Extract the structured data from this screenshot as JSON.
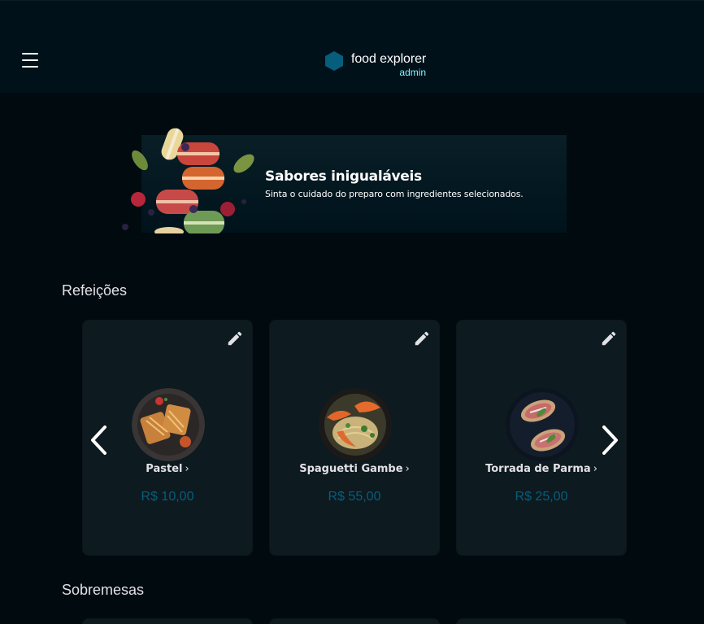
{
  "header": {
    "brand_name": "food explorer",
    "brand_role": "admin",
    "menu_icon": "hamburger-menu-icon",
    "logo_icon": "hexagon-logo-icon",
    "accent_color": "#82f3ff",
    "logo_color": "#065e7c"
  },
  "banner": {
    "title": "Sabores inigualáveis",
    "subtitle": "Sinta o cuidado do preparo com ingredientes selecionados."
  },
  "sections": [
    {
      "title": "Refeições",
      "cards": [
        {
          "name": "Pastel",
          "chevron": "›",
          "price": "R$ 10,00",
          "icon": "pencil-edit-icon"
        },
        {
          "name": "Spaguetti Gambe",
          "chevron": "›",
          "price": "R$ 55,00",
          "icon": "pencil-edit-icon"
        },
        {
          "name": "Torrada de Parma",
          "chevron": "›",
          "price": "R$ 25,00",
          "icon": "pencil-edit-icon"
        }
      ]
    },
    {
      "title": "Sobremesas",
      "cards": []
    }
  ],
  "colors": {
    "price": "#065e7c",
    "card_bg": "#0d1a20",
    "page_bg": "#000a0f",
    "header_bg": "#00111a"
  }
}
